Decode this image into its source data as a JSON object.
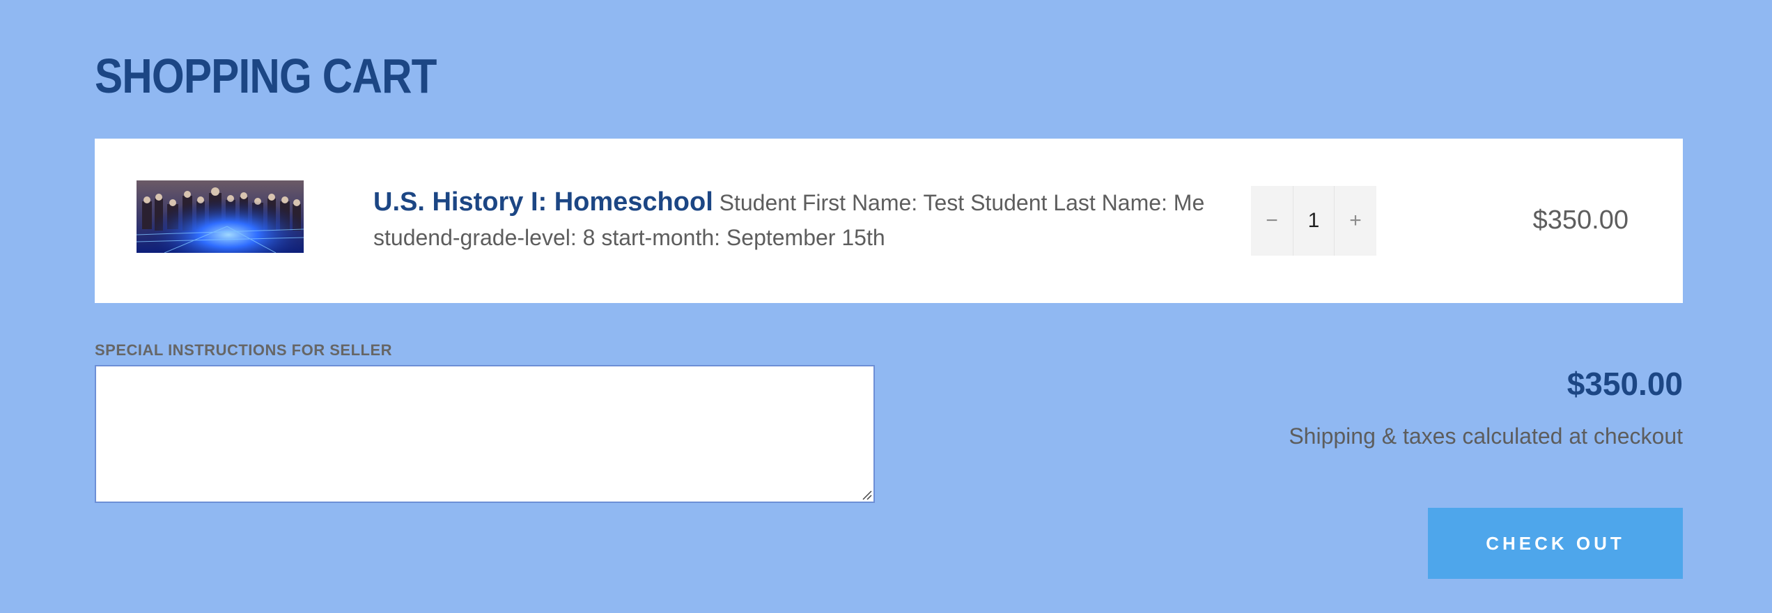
{
  "page": {
    "title": "SHOPPING CART"
  },
  "cart": {
    "items": [
      {
        "title": "U.S. History I: Homeschool",
        "properties": "Student First Name: Test Student Last Name: Me studend-grade-level: 8 start-month: September 15th",
        "quantity": "1",
        "decrease_symbol": "−",
        "increase_symbol": "+",
        "price": "$350.00",
        "image_icon": "founding-fathers-painting-thumbnail"
      }
    ]
  },
  "instructions": {
    "label": "SPECIAL INSTRUCTIONS FOR SELLER",
    "value": ""
  },
  "summary": {
    "subtotal": "$350.00",
    "shipping_note": "Shipping & taxes calculated at checkout",
    "checkout_label": "CHECK OUT"
  },
  "colors": {
    "background": "#90b8f2",
    "heading": "#1c4684",
    "checkout_button": "#4ea6eb",
    "body_text": "#5d5d5d"
  }
}
